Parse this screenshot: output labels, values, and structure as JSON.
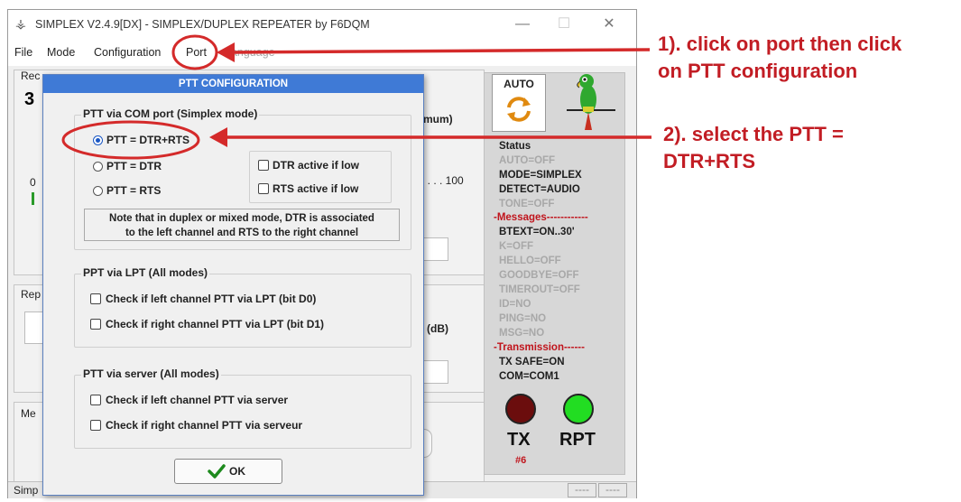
{
  "window": {
    "title": "SIMPLEX V2.4.9[DX] - SIMPLEX/DUPLEX REPEATER by F6DQM",
    "minimize_glyph": "—",
    "maximize_glyph": "☐",
    "close_glyph": "✕"
  },
  "menu": {
    "items": [
      "File",
      "Mode",
      "Configuration",
      "Port",
      "Language"
    ]
  },
  "background": {
    "group1_label": "Rec",
    "big_digit": "3",
    "range_min": "0",
    "range_max": ". . . . 100",
    "minimum_suffix": "mum)",
    "group2_label": "Rep",
    "db_label": "(dB)",
    "group3_label": "Me",
    "statusbar_left": "Simp",
    "statusbar_cells": [
      "----",
      "----"
    ]
  },
  "dialog": {
    "title": "PTT CONFIGURATION",
    "com_group": {
      "legend": "PTT via COM port (Simplex mode)",
      "radios": [
        {
          "label": "PTT = DTR+RTS",
          "selected": true
        },
        {
          "label": "PTT = DTR",
          "selected": false
        },
        {
          "label": "PTT = RTS",
          "selected": false
        }
      ],
      "checkboxes": [
        {
          "label": "DTR active if low",
          "checked": false
        },
        {
          "label": "RTS active if low",
          "checked": false
        }
      ],
      "note_line1": "Note that in duplex or mixed mode, DTR is associated",
      "note_line2": "to the left channel and RTS to the right channel"
    },
    "lpt_group": {
      "legend": "PPT via LPT (All modes)",
      "checkboxes": [
        {
          "label": "Check if left channel PTT via LPT (bit D0)",
          "checked": false
        },
        {
          "label": "Check if right channel PTT via LPT (bit D1)",
          "checked": false
        }
      ]
    },
    "server_group": {
      "legend": "PTT via server (All modes)",
      "checkboxes": [
        {
          "label": "Check if left channel PTT via server",
          "checked": false
        },
        {
          "label": "Check if right channel PTT via serveur",
          "checked": false
        }
      ]
    },
    "ok_label": "OK"
  },
  "status_panel": {
    "auto_label": "AUTO",
    "status_header": "Status",
    "status_lines": [
      {
        "text": "AUTO=OFF",
        "active": false
      },
      {
        "text": "MODE=SIMPLEX",
        "active": true
      },
      {
        "text": "DETECT=AUDIO",
        "active": true
      },
      {
        "text": "TONE=OFF",
        "active": false
      }
    ],
    "messages_header": "-Messages------------",
    "message_lines": [
      {
        "text": "BTEXT=ON..30'",
        "active": true
      },
      {
        "text": "K=OFF",
        "active": false
      },
      {
        "text": "HELLO=OFF",
        "active": false
      },
      {
        "text": "GOODBYE=OFF",
        "active": false
      },
      {
        "text": "TIMEROUT=OFF",
        "active": false
      },
      {
        "text": "ID=NO",
        "active": false
      },
      {
        "text": "PING=NO",
        "active": false
      },
      {
        "text": "MSG=NO",
        "active": false
      }
    ],
    "transmission_header": "-Transmission------",
    "transmission_lines": [
      {
        "text": "TX SAFE=ON",
        "active": true
      },
      {
        "text": "COM=COM1",
        "active": true
      }
    ],
    "tx_label": "TX",
    "rpt_label": "RPT",
    "counter": "#6",
    "tx_led_color": "#6b0d0d",
    "rpt_led_color": "#22dd22"
  },
  "annotations": {
    "step1_line1": "1). click on port then click",
    "step1_line2": "on PTT configuration",
    "step2_line1": "2). select the PTT =",
    "step2_line2": "DTR+RTS",
    "color": "#c21d24"
  }
}
